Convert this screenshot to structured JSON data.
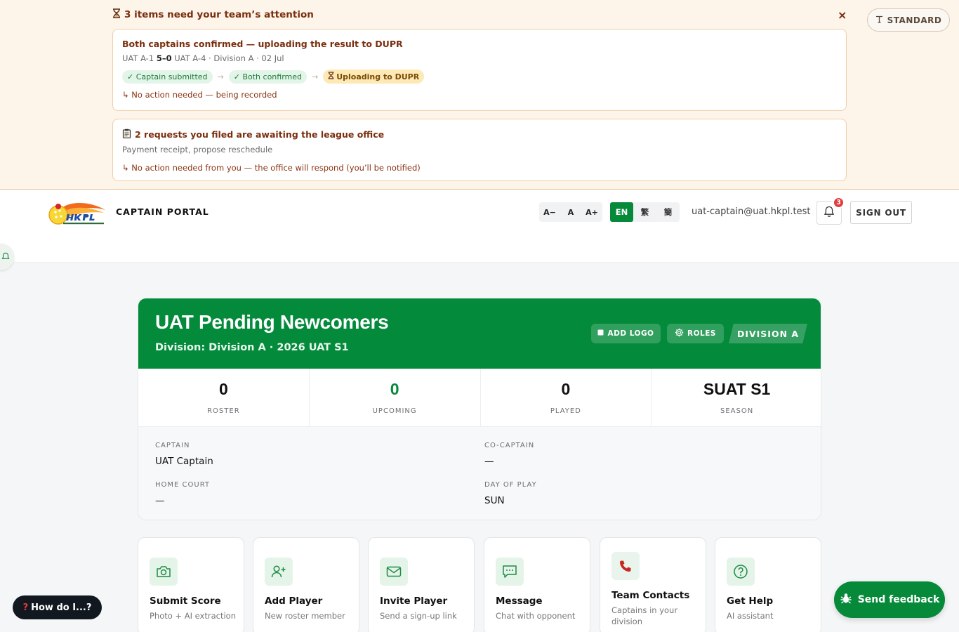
{
  "banner": {
    "icon": "hourglass-icon",
    "title": "3 items need your team’s attention",
    "close_label": "×",
    "standard_label": "STANDARD",
    "cards": [
      {
        "title": "Both captains confirmed — uploading the result to DUPR",
        "match_home": "UAT A-1",
        "match_score": "5–0",
        "match_rest": "UAT A-4 · Division A · 02 Jul",
        "steps": [
          "✓ Captain submitted",
          "✓ Both confirmed",
          "Uploading to DUPR"
        ],
        "arrow": "→",
        "note": "↳ No action needed — being recorded"
      },
      {
        "icon": "clipboard-icon",
        "title": "2 requests you filed are awaiting the league office",
        "subtitle": "Payment receipt, propose reschedule",
        "note": "↳ No action needed from you — the office will respond (you’ll be notified)"
      }
    ]
  },
  "header": {
    "portal_title": "CAPTAIN PORTAL",
    "font_sizes": [
      "A−",
      "A",
      "A+"
    ],
    "languages": [
      "EN",
      "繁",
      "簡"
    ],
    "active_language": "EN",
    "user_email": "uat-captain@uat.hkpl.test",
    "notification_count": "3",
    "sign_out_label": "SIGN OUT"
  },
  "team": {
    "name": "UAT Pending Newcomers",
    "subtitle": "Division: Division A · 2026 UAT S1",
    "add_logo_label": "ADD LOGO",
    "roles_label": "ROLES",
    "division_tag": "DIVISION A",
    "stats": [
      {
        "value": "0",
        "label": "ROSTER"
      },
      {
        "value": "0",
        "label": "UPCOMING"
      },
      {
        "value": "0",
        "label": "PLAYED"
      },
      {
        "value": "SUAT S1",
        "label": "SEASON"
      }
    ],
    "details": {
      "captain_label": "CAPTAIN",
      "captain_value": "UAT Captain",
      "cocaptain_label": "CO-CAPTAIN",
      "cocaptain_value": "—",
      "homecourt_label": "HOME COURT",
      "homecourt_value": "—",
      "dayofplay_label": "DAY OF PLAY",
      "dayofplay_value": "SUN"
    }
  },
  "actions": [
    {
      "title": "Submit Score",
      "desc": "Photo + AI extraction",
      "icon": "camera-icon"
    },
    {
      "title": "Add Player",
      "desc": "New roster member",
      "icon": "user-plus-icon"
    },
    {
      "title": "Invite Player",
      "desc": "Send a sign-up link",
      "icon": "mail-icon"
    },
    {
      "title": "Message",
      "desc": "Chat with opponent",
      "icon": "chat-icon"
    },
    {
      "title": "Team Contacts",
      "desc": "Captains in your division",
      "icon": "phone-icon"
    },
    {
      "title": "Get Help",
      "desc": "AI assistant",
      "icon": "help-icon"
    }
  ],
  "floating": {
    "how_do_i_label": "How do I...?",
    "feedback_label": "Send feedback"
  },
  "colors": {
    "brand_green": "#068a3a",
    "banner_bg": "#fdf4ea",
    "banner_text": "#7a2e0e",
    "badge_red": "#e23b3b"
  }
}
